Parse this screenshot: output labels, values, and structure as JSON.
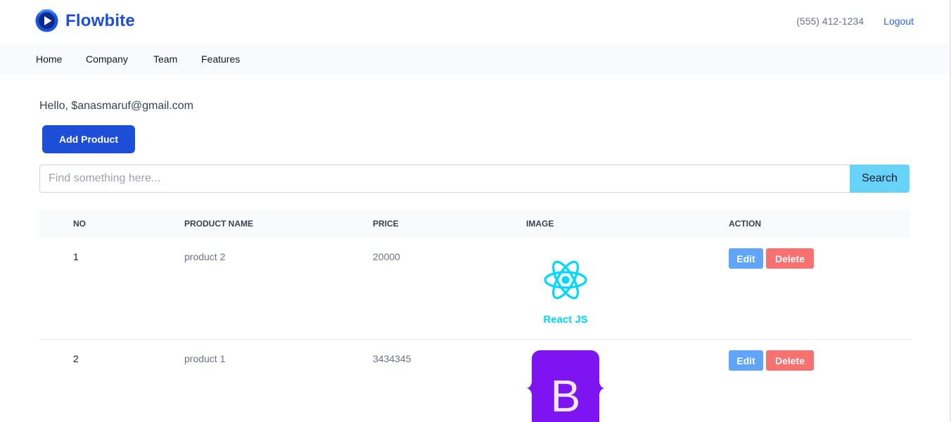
{
  "header": {
    "brand": "Flowbite",
    "phone": "(555) 412-1234",
    "logout_label": "Logout"
  },
  "nav": {
    "items": [
      "Home",
      "Company",
      "Team",
      "Features"
    ]
  },
  "main": {
    "greeting": "Hello, $anasmaruf@gmail.com",
    "add_product_label": "Add Product",
    "search": {
      "placeholder": "Find something here...",
      "value": "",
      "button_label": "Search"
    }
  },
  "table": {
    "columns": [
      "No",
      "Product Name",
      "Price",
      "Image",
      "Action"
    ],
    "rows": [
      {
        "no": "1",
        "name": "product 2",
        "price": "20000",
        "image_icon": "react-js-logo",
        "image_text": "React JS",
        "edit_label": "Edit",
        "delete_label": "Delete"
      },
      {
        "no": "2",
        "name": "product 1",
        "price": "3434345",
        "image_icon": "bootstrap-logo",
        "image_text": "B",
        "edit_label": "Edit",
        "delete_label": "Delete"
      }
    ]
  },
  "colors": {
    "brand": "#1d4ed8",
    "search_button": "#67d3f9",
    "edit_button": "#60a5fa",
    "delete_button": "#f87171",
    "react": "#00d8ff",
    "bootstrap": "#7e14f2"
  }
}
